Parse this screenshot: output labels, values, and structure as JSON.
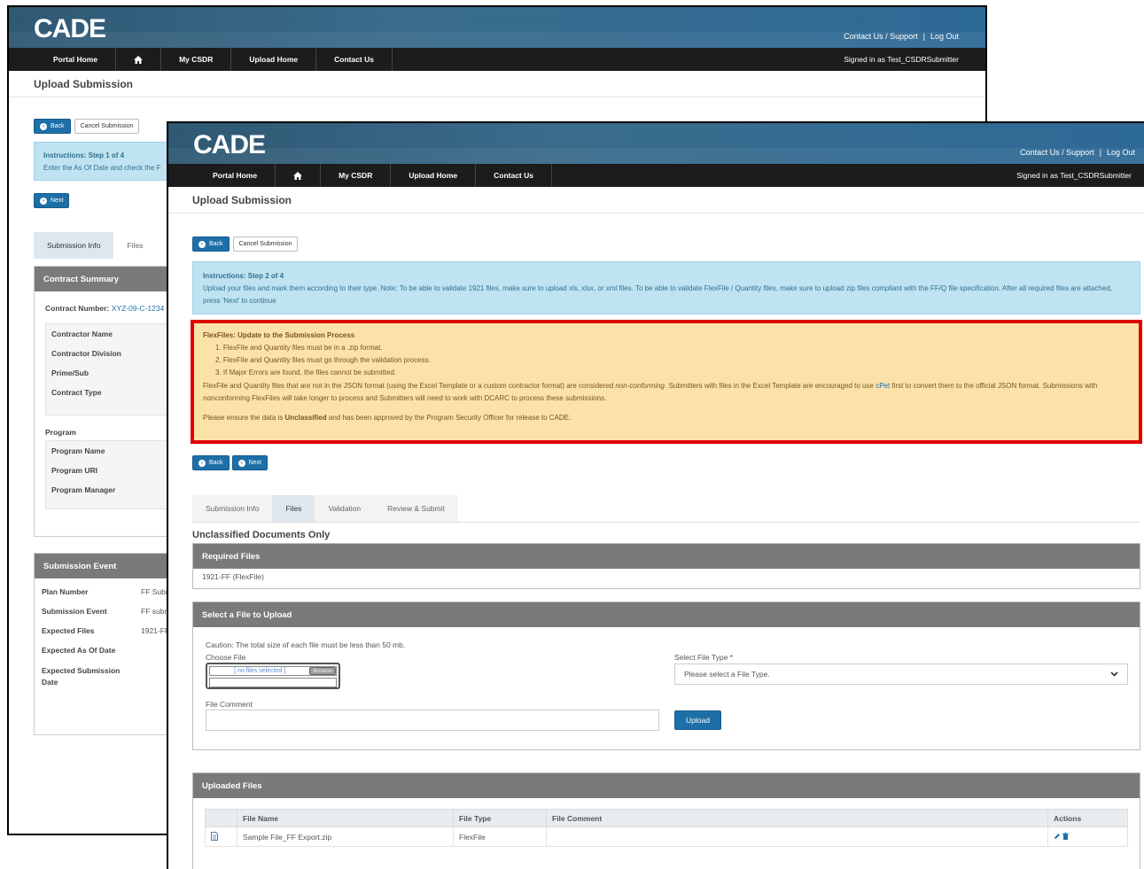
{
  "brand": {
    "logo_text": "CADE"
  },
  "header": {
    "contact_link": "Contact Us / Support",
    "separator": "|",
    "logout_link": "Log Out"
  },
  "nav": {
    "portal_home": "Portal Home",
    "home_icon": "home-icon",
    "my_csdr": "My CSDR",
    "upload_home": "Upload Home",
    "contact_us": "Contact Us",
    "signed_in": "Signed in as Test_CSDRSubmitter"
  },
  "page_title": "Upload Submission",
  "buttons": {
    "back": "Back",
    "cancel": "Cancel Submission",
    "next": "Next",
    "upload": "Upload"
  },
  "back_window": {
    "instructions_title": "Instructions: Step 1 of 4",
    "instructions_text": "Enter the As Of Date and check the F",
    "tabs": [
      "Submission Info",
      "Files"
    ],
    "contract_summary_title": "Contract Summary",
    "contract_number_label": "Contract Number:",
    "contract_number_value": "XYZ-09-C-1234",
    "contract_fields": [
      "Contractor Name",
      "Contractor Division",
      "Prime/Sub",
      "Contract Type"
    ],
    "program_heading": "Program",
    "program_fields": [
      "Program Name",
      "Program URI",
      "Program Manager"
    ],
    "submission_event_title": "Submission Event",
    "submission_event_rows": [
      {
        "label": "Plan Number",
        "value": "FF Subm"
      },
      {
        "label": "Submission Event",
        "value": "FF subm"
      },
      {
        "label": "Expected Files",
        "value": "1921-FF"
      },
      {
        "label": "Expected As Of Date",
        "value": ""
      },
      {
        "label": "Expected Submission Date",
        "value": ""
      }
    ]
  },
  "front_window": {
    "instructions_title": "Instructions: Step 2 of 4",
    "instructions_text": "Upload your files and mark them according to their type. Note: To be able to validate 1921 files, make sure to upload xls, xlsx, or xml files. To be able to validate FlexFile / Quantity files, make sure to upload zip files compliant with the FF/Q file specification. After all required files are attached, press 'Next' to continue",
    "flexfile_notice": {
      "title": "FlexFiles: Update to the Submission Process",
      "items": [
        "1. FlexFile and Quantity files must be in a .zip format.",
        "2. FlexFile and Quantity files must go through the validation process.",
        "3. If Major Errors are found, the files cannot be submitted."
      ],
      "para1_start": "FlexFile and Quantity files that are not in the JSON format (using the Excel Template or a custom contractor format) are considered ",
      "para1_em": "non-conforming",
      "para1_mid": ". Submitters with files in the Excel Template are encouraged to use ",
      "para1_link": "cPet",
      "para1_end": " first to convert them to the official JSON format. Submissions with nonconforming FlexFiles will take longer to process and Submitters will need to work with DCARC to process these submissions.",
      "para2_start": "Please ensure the data is ",
      "para2_bold": "Unclassified",
      "para2_end": " and has been approved by the Program Security Officer for release to CADE."
    },
    "tabs": [
      "Submission Info",
      "Files",
      "Validation",
      "Review & Submit"
    ],
    "unclassified_heading": "Unclassified Documents Only",
    "required_files_title": "Required Files",
    "required_files_item": "1921-FF (FlexFile)",
    "select_file_title": "Select a File to Upload",
    "caution_text": "Caution: The total size of each file must be less than 50 mb.",
    "choose_file_label": "Choose File",
    "no_files_text": "[ no files selected ]",
    "browse_text": "Browse",
    "file_type_label": "Select File Type *",
    "file_type_placeholder": "Please select a File Type.",
    "file_comment_label": "File Comment",
    "uploaded_files_title": "Uploaded Files",
    "table_headers": [
      "File Name",
      "File Type",
      "File Comment",
      "Actions"
    ],
    "table_rows": [
      {
        "file_name": "Sample File_FF Export.zip",
        "file_type": "FlexFile",
        "file_comment": ""
      }
    ]
  }
}
